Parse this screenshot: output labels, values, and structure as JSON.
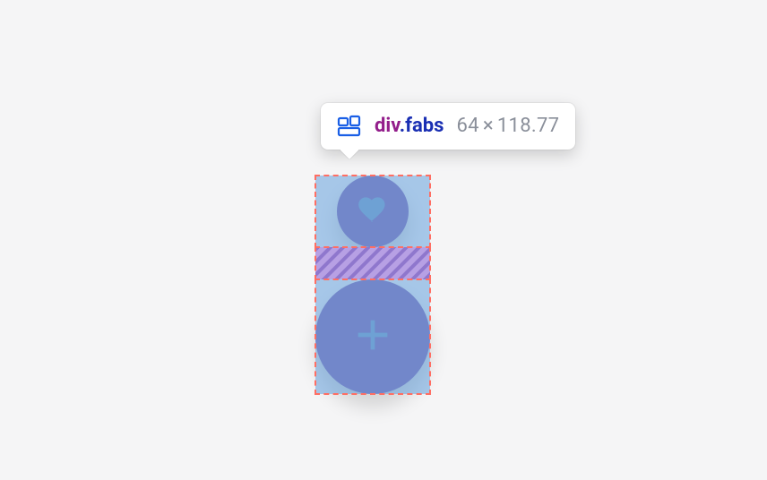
{
  "inspected": {
    "tag": "div",
    "class": ".fabs",
    "width": "64",
    "height": "118.77"
  },
  "fabs": {
    "items": [
      {
        "icon": "heart-icon",
        "size": "small"
      },
      {
        "icon": "plus-icon",
        "size": "large"
      }
    ]
  },
  "colors": {
    "fab_bg": "#8368b3",
    "fab_icon": "#7ba3c9",
    "overlay_content": "rgba(101,160,220,0.55)",
    "overlay_margin_fill": "#b7a0e4",
    "overlay_margin_stripe": "#8f77cd",
    "outline": "#ff6e63"
  }
}
